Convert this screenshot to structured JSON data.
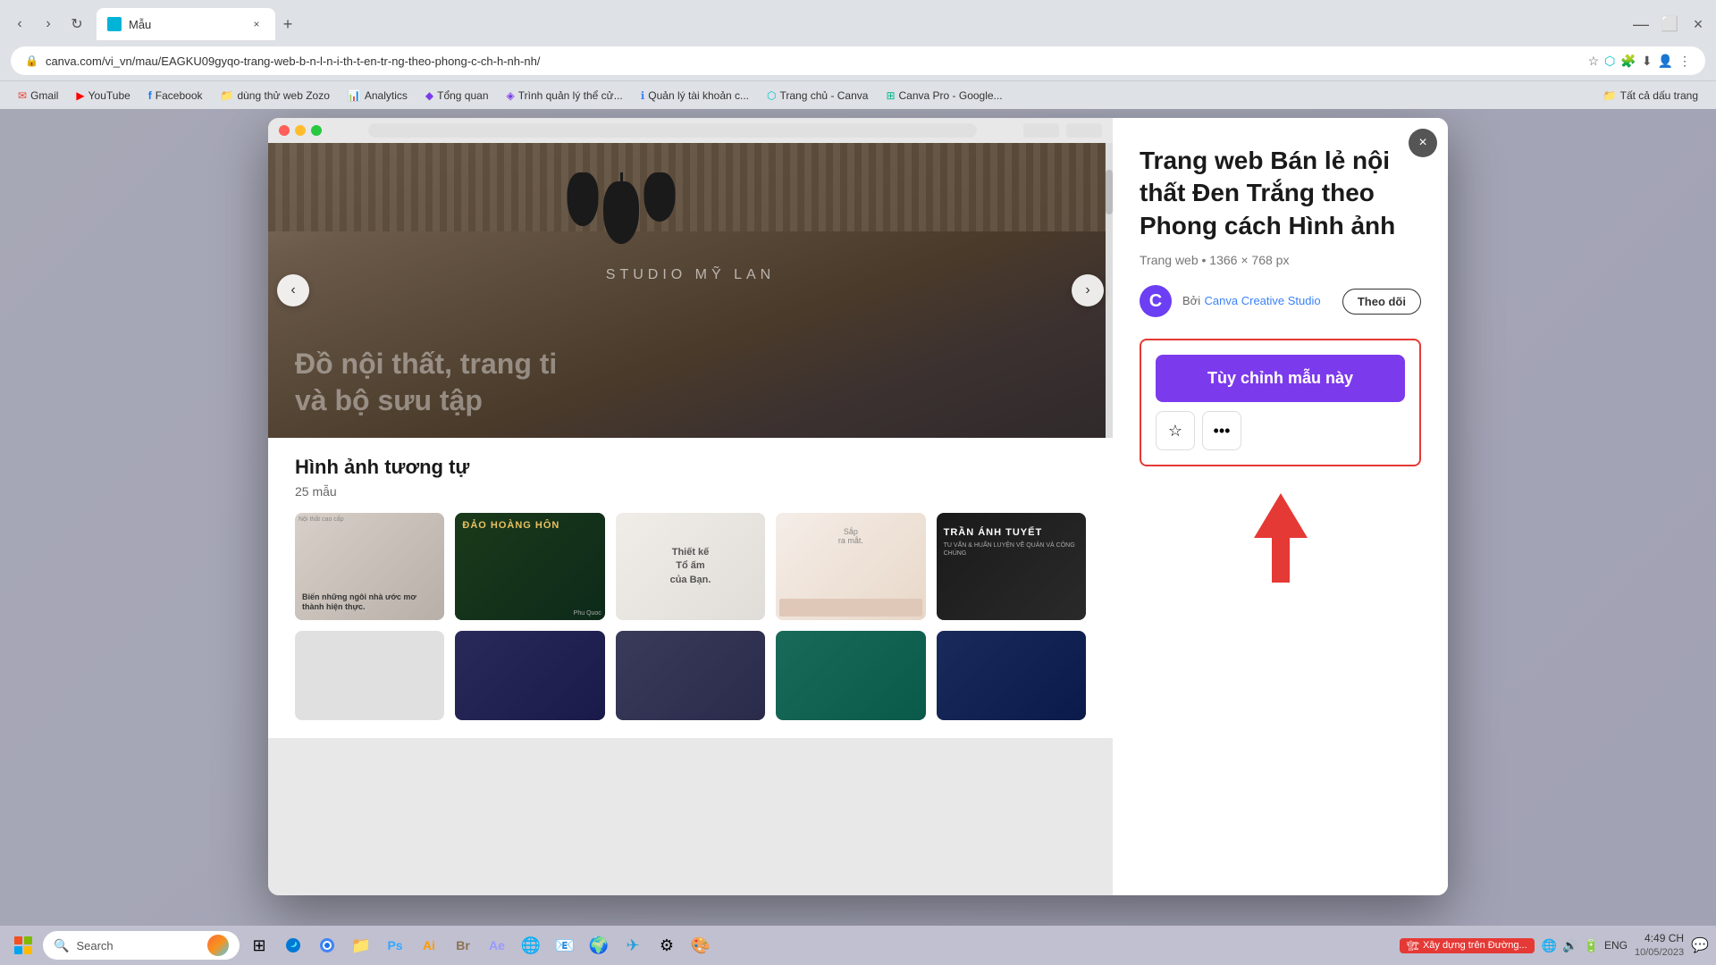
{
  "browser": {
    "tab": {
      "label": "Mẫu",
      "favicon_color": "#00b4d8"
    },
    "address": "canva.com/vi_vn/mau/EAGKU09gyqo-trang-web-b-n-l-n-i-th-t-en-tr-ng-theo-phong-c-ch-h-nh-nh/",
    "bookmarks": [
      {
        "label": "Gmail",
        "icon": "✉",
        "color": "#ea4335"
      },
      {
        "label": "YouTube",
        "icon": "▶",
        "color": "#ff0000"
      },
      {
        "label": "Facebook",
        "icon": "f",
        "color": "#1877f2"
      },
      {
        "label": "dùng thử web Zozo",
        "icon": "📁",
        "color": "#ffd700"
      },
      {
        "label": "Analytics",
        "icon": "📊",
        "color": "#4285f4"
      },
      {
        "label": "Tổng quan",
        "icon": "◆",
        "color": "#7c3aed"
      },
      {
        "label": "Trình quản lý thể cử...",
        "icon": "◈",
        "color": "#7c3aed"
      },
      {
        "label": "Quản lý tài khoản c...",
        "icon": "ℹ",
        "color": "#4285f4"
      },
      {
        "label": "Trang chủ - Canva",
        "icon": "⬡",
        "color": "#00c4cc"
      },
      {
        "label": "Canva Pro - Google...",
        "icon": "⊞",
        "color": "#00b88a"
      },
      {
        "label": "Tất cả dấu trang",
        "icon": "»",
        "color": "#555"
      }
    ]
  },
  "modal": {
    "close_label": "×",
    "preview": {
      "studio_text": "STUDIO MỸ LAN",
      "overlay_text": "Đồ nội thất, trang trí\nvà bộ sưu tập"
    },
    "template": {
      "title": "Trang web Bán lẻ nội thất Đen Trắng theo Phong cách Hình ảnh",
      "meta": "Trang web • 1366 × 768 px",
      "author_by": "Bởi",
      "author_name": "Canva Creative Studio",
      "follow_label": "Theo dõi",
      "customize_label": "Tùy chỉnh mẫu này"
    },
    "similar": {
      "title": "Hình ảnh tương tự",
      "count": "25 mẫu",
      "cards": [
        {
          "label": "Biến những ngôi nhà ước mơ thành hiện thực.",
          "style": "card-1"
        },
        {
          "label": "ĐẢO HOÀNG HÔN",
          "style": "card-2"
        },
        {
          "label": "Thiết kế Tổ ấm của Bạn.",
          "style": "card-3"
        },
        {
          "label": "Sắp ra mắt.",
          "style": "card-4"
        },
        {
          "label": "TRẦN ÁNH TUYẾT",
          "style": "card-5"
        }
      ],
      "cards2": [
        {
          "label": "",
          "style": "card-6"
        },
        {
          "label": "",
          "style": "card-7"
        },
        {
          "label": "",
          "style": "card-8"
        },
        {
          "label": "",
          "style": "card-9"
        },
        {
          "label": "",
          "style": "card-10"
        }
      ]
    }
  },
  "taskbar": {
    "search_label": "Search",
    "notification_label": "Xây dựng trên Đường...",
    "time": "4:49 CH",
    "lang": "ENG"
  }
}
